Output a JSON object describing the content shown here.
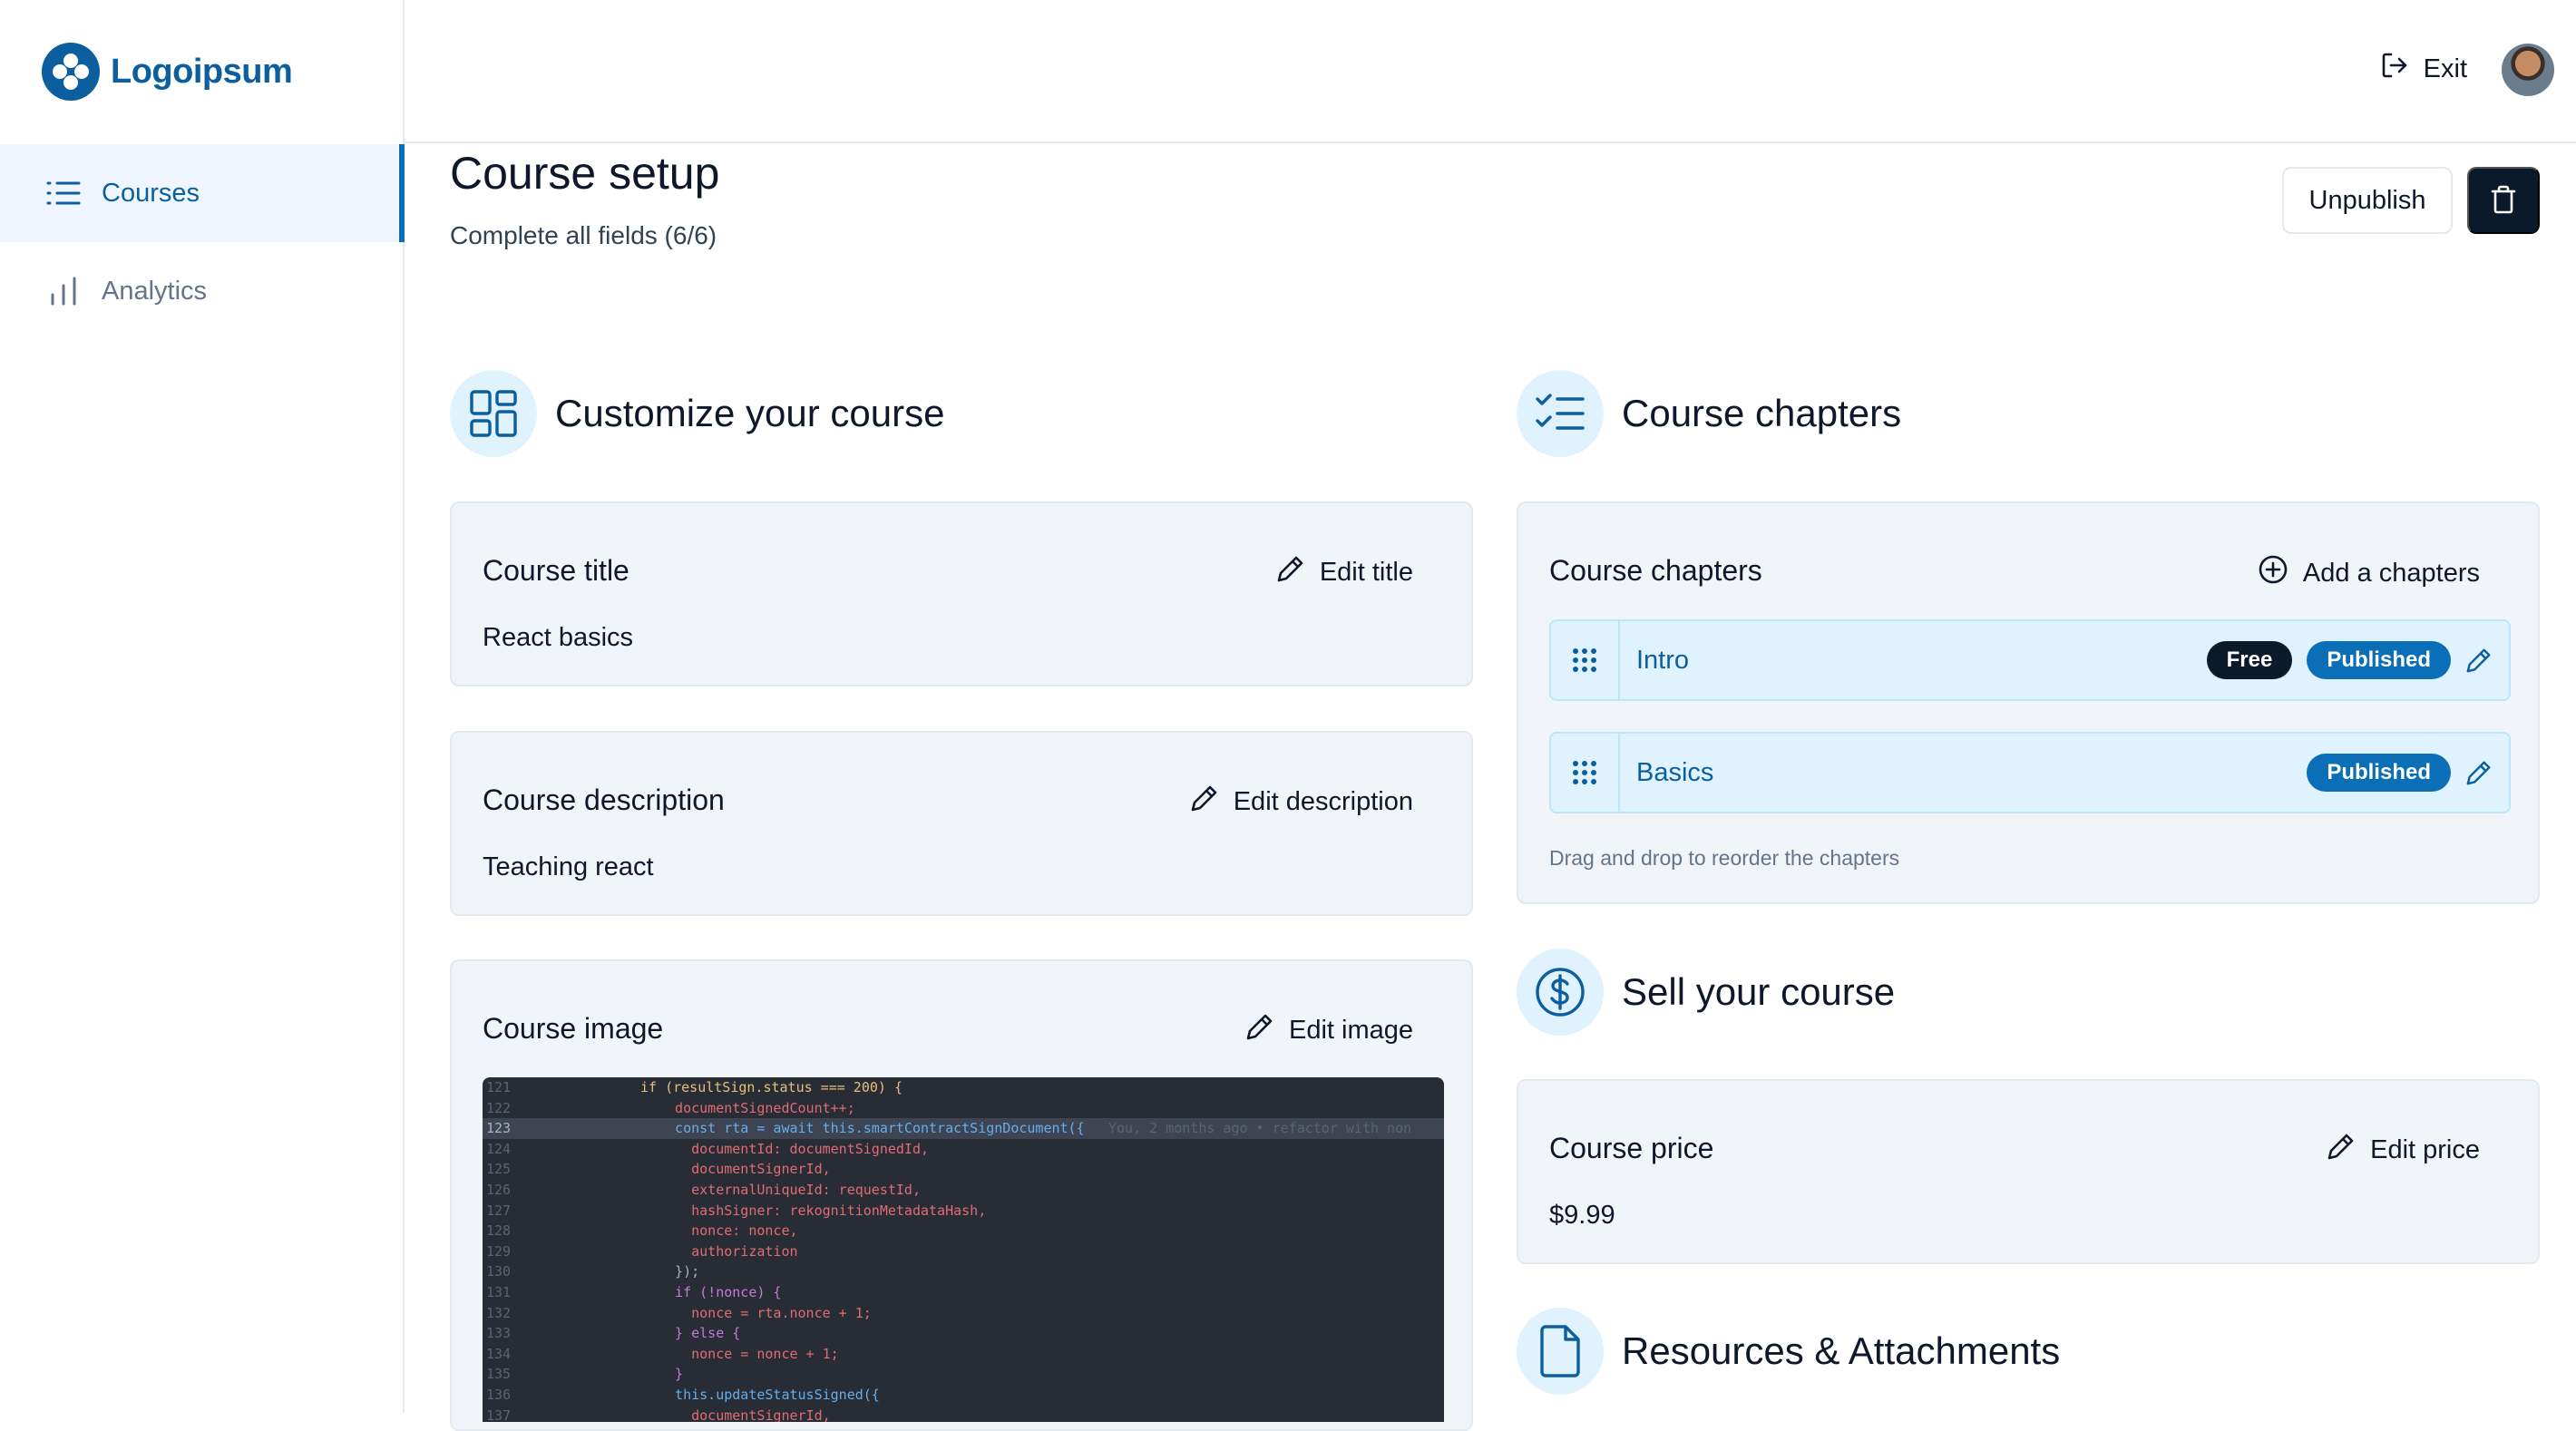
{
  "brand": {
    "name": "Logoipsum",
    "color": "#0b5f9e"
  },
  "sidebar": {
    "items": [
      {
        "label": "Courses",
        "icon": "list-icon",
        "active": true
      },
      {
        "label": "Analytics",
        "icon": "bar-chart-icon",
        "active": false
      }
    ]
  },
  "topbar": {
    "exit_label": "Exit",
    "avatar": "user-avatar"
  },
  "header": {
    "title": "Course setup",
    "subtitle": "Complete all fields (6/6)",
    "unpublish_label": "Unpublish",
    "delete_icon": "trash-icon"
  },
  "customize": {
    "title": "Customize your course",
    "icon": "layout-dashboard-icon",
    "course_title": {
      "label": "Course title",
      "value": "React basics",
      "action": "Edit title"
    },
    "course_description": {
      "label": "Course description",
      "value": "Teaching react",
      "action": "Edit description"
    },
    "course_image": {
      "label": "Course image",
      "action": "Edit image"
    }
  },
  "code_image": {
    "lines": [
      {
        "ln": "121",
        "text": "if (resultSign.status === 200) {"
      },
      {
        "ln": "122",
        "text": "  documentSignedCount++;"
      },
      {
        "ln": "123",
        "text": "  const rta = await this.smartContractSignDocument({"
      },
      {
        "ln": "124",
        "text": "    documentId: documentSignedId,"
      },
      {
        "ln": "125",
        "text": "    documentSignerId,"
      },
      {
        "ln": "126",
        "text": "    externalUniqueId: requestId,"
      },
      {
        "ln": "127",
        "text": "    hashSigner: rekognitionMetadataHash,"
      },
      {
        "ln": "128",
        "text": "    nonce: nonce,"
      },
      {
        "ln": "129",
        "text": "    authorization"
      },
      {
        "ln": "130",
        "text": "  });"
      },
      {
        "ln": "131",
        "text": "  if (!nonce) {"
      },
      {
        "ln": "132",
        "text": "    nonce = rta.nonce + 1;"
      },
      {
        "ln": "133",
        "text": "  } else {"
      },
      {
        "ln": "134",
        "text": "    nonce = nonce + 1;"
      },
      {
        "ln": "135",
        "text": "  }"
      },
      {
        "ln": "136",
        "text": "  this.updateStatusSigned({"
      },
      {
        "ln": "137",
        "text": "    documentSignerId,"
      }
    ],
    "blame": "You, 2 months ago • refactor with non"
  },
  "chapters": {
    "title": "Course chapters",
    "icon": "list-checks-icon",
    "card_label": "Course chapters",
    "add_label": "Add a chapters",
    "items": [
      {
        "name": "Intro",
        "free": "Free",
        "status": "Published"
      },
      {
        "name": "Basics",
        "status": "Published"
      }
    ],
    "hint": "Drag and drop to reorder the chapters"
  },
  "sell": {
    "title": "Sell your course",
    "icon": "circle-dollar-icon",
    "price_label": "Course price",
    "price_value": "$9.99",
    "action": "Edit price"
  },
  "resources": {
    "title": "Resources & Attachments",
    "icon": "file-icon"
  }
}
